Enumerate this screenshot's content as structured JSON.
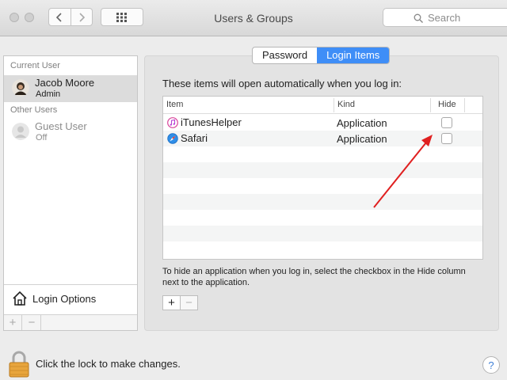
{
  "window": {
    "title": "Users & Groups"
  },
  "toolbar": {
    "search_placeholder": "Search"
  },
  "sidebar": {
    "current_user_header": "Current User",
    "current_user": {
      "name": "Jacob Moore",
      "role": "Admin"
    },
    "other_users_header": "Other Users",
    "other_users": [
      {
        "name": "Guest User",
        "status": "Off"
      }
    ],
    "login_options_label": "Login Options",
    "add_label": "+",
    "remove_label": "−"
  },
  "tabs": [
    {
      "label": "Password",
      "active": false
    },
    {
      "label": "Login Items",
      "active": true
    }
  ],
  "main": {
    "intro": "These items will open automatically when you log in:",
    "columns": {
      "item": "Item",
      "kind": "Kind",
      "hide": "Hide"
    },
    "rows": [
      {
        "item": "iTunesHelper",
        "kind": "Application",
        "hide": false,
        "icon": "itunes-icon"
      },
      {
        "item": "Safari",
        "kind": "Application",
        "hide": false,
        "icon": "safari-icon"
      }
    ],
    "hint": "To hide an application when you log in, select the checkbox in the Hide column next to the application.",
    "add_label": "+",
    "remove_label": "−"
  },
  "footer": {
    "lock_label": "Click the lock to make changes.",
    "help_label": "?"
  },
  "colors": {
    "accent": "#3f8ef7",
    "annotation_arrow": "#e02020"
  }
}
